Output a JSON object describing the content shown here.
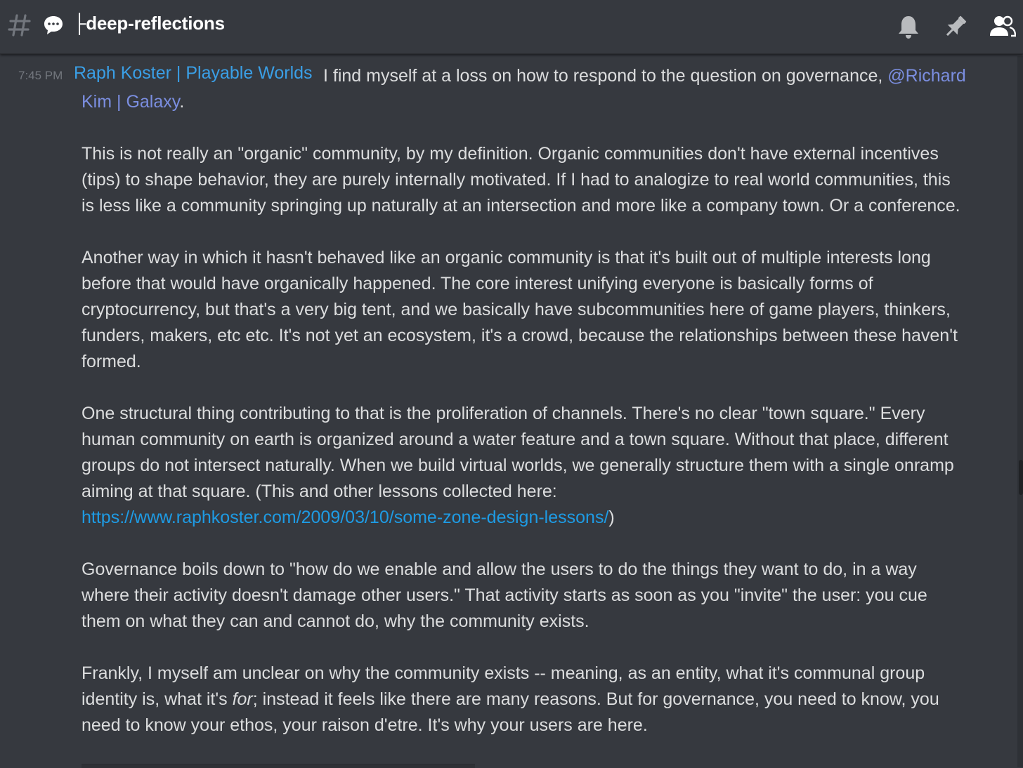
{
  "header": {
    "channel_name": "├deep-reflections",
    "icons": [
      "hash-icon",
      "speech-bubble-icon",
      "bell-icon",
      "pin-icon",
      "members-icon"
    ]
  },
  "message": {
    "timestamp": "7:45 PM",
    "author": "Raph Koster | Playable Worlds",
    "author_color": "#3a9fe6",
    "intro": "I find myself at a loss on how to respond to the question on governance,",
    "mention": "@Richard Kim | Galaxy",
    "mention_suffix": ".",
    "p1": "This is not really an \"organic\" community, by my definition. Organic communities don't have external incentives (tips) to shape behavior, they are purely internally motivated. If I had to analogize to real world communities, this is less like a community springing up naturally at an intersection and more like a company town. Or a conference.",
    "p2": "Another way in which it hasn't behaved like an organic community is that it's built out of multiple interests long before that would have organically happened. The core interest unifying everyone is basically forms of cryptocurrency, but that's a very big tent, and we basically have subcommunities here of game players, thinkers, funders, makers, etc etc. It's not yet an ecosystem, it's a crowd, because the relationships between these haven't formed.",
    "p3": "One structural thing contributing to that is the proliferation of channels. There's no clear \"town square.\" Every human community on earth is organized around a water feature and a town square. Without that place, different groups do not intersect naturally. When we build virtual worlds, we generally structure them with a single onramp aiming at that square. (This and other lessons collected here:",
    "p3_link": "https://www.raphkoster.com/2009/03/10/some-zone-design-lessons/",
    "p3_close": ")",
    "p4": "Governance boils down to \"how do we enable and allow the users to do the things they want to do, in a way where their activity doesn't damage other users.\" That activity starts as soon as you \"invite\" the user: you cue them on what they can and cannot do, why the community exists.",
    "p5_start": "Frankly, I myself am unclear on why the community exists -- meaning, as an entity, what it's communal group identity is, what it's ",
    "p5_em": "for",
    "p5_end": "; instead it feels like there are many reasons. But for governance, you need to know, you need to know your ethos, your raison d'etre. It's why your users are here."
  },
  "colors": {
    "background": "#36393f",
    "text": "#dcddde",
    "mention": "#7b8ee0",
    "link": "#1e9be4",
    "timestamp": "#72767d"
  }
}
